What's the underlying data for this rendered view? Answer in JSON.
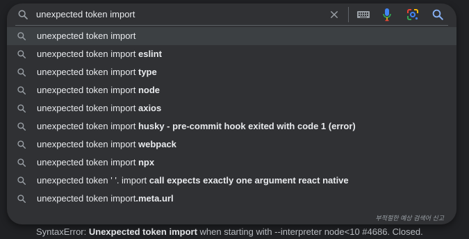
{
  "search": {
    "value": "unexpected token import",
    "icon": "search-icon"
  },
  "suggestions": [
    {
      "prefix": "unexpected token import",
      "bold": ""
    },
    {
      "prefix": "unexpected token import ",
      "bold": "eslint"
    },
    {
      "prefix": "unexpected token import ",
      "bold": "type"
    },
    {
      "prefix": "unexpected token import ",
      "bold": "node"
    },
    {
      "prefix": "unexpected token import ",
      "bold": "axios"
    },
    {
      "prefix": "unexpected token import ",
      "bold": "husky - pre-commit hook exited with code 1 (error)"
    },
    {
      "prefix": "unexpected token import ",
      "bold": "webpack"
    },
    {
      "prefix": "unexpected token import ",
      "bold": "npx"
    },
    {
      "prefix": "unexpected token ' '. import ",
      "bold": "call expects exactly one argument react native"
    },
    {
      "prefix": "unexpected token import",
      "bold": ".meta.url"
    }
  ],
  "report_link": "부적절한 예상 검색어 신고",
  "background_result": {
    "label": "SyntaxError",
    "sep": ": ",
    "bold": "Unexpected token import",
    "rest": " when starting with --interpreter node<10 #4686. Closed."
  },
  "colors": {
    "dropdown_bg": "#303134",
    "page_bg": "#202124",
    "text": "#e8eaed",
    "active_row": "#3c4043"
  }
}
